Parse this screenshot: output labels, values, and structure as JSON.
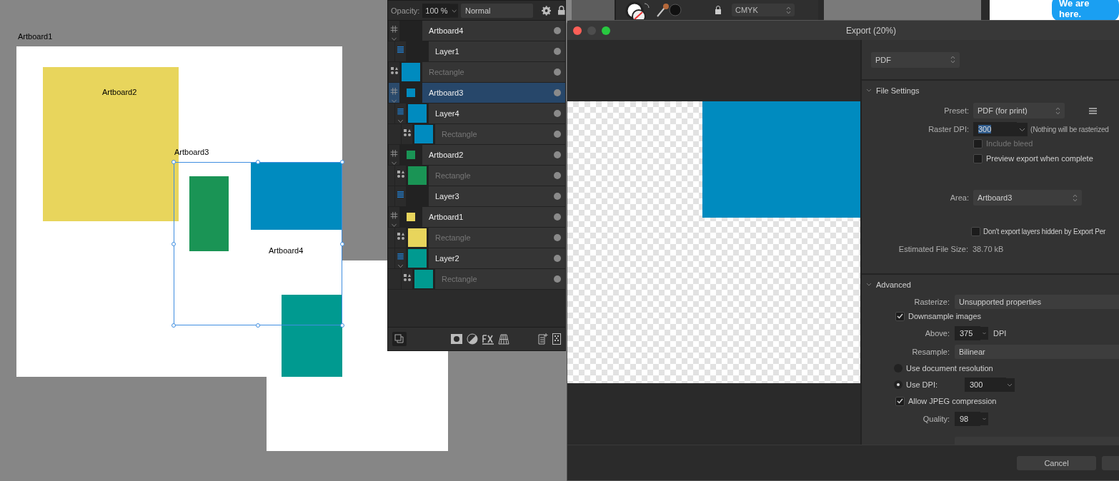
{
  "canvas": {
    "artboards": [
      {
        "label": "Artboard1",
        "selected": false
      },
      {
        "label": "Artboard2",
        "selected": false
      },
      {
        "label": "Artboard3",
        "selected": true
      },
      {
        "label": "Artboard4",
        "selected": false
      }
    ]
  },
  "background_windows": {
    "color_mode": "CMYK",
    "chat_bubble": "We are here."
  },
  "layers_panel": {
    "opacity_label": "Opacity:",
    "opacity": "100 %",
    "blend_mode": "Normal",
    "layers": [
      {
        "name": "Artboard4",
        "kind": "artboard",
        "selected": false,
        "expanded": true,
        "children": [
          {
            "name": "Layer1",
            "kind": "layer",
            "selected": false
          }
        ]
      },
      {
        "name": "Rectangle",
        "kind": "shape",
        "selected": false,
        "color": "#008bbf"
      },
      {
        "name": "Artboard3",
        "kind": "artboard",
        "selected": true,
        "expanded": true,
        "color": "#008bbf",
        "children": [
          {
            "name": "Layer4",
            "kind": "layer",
            "selected": false,
            "expanded": true,
            "color": "#008bbf",
            "children": [
              {
                "name": "Rectangle",
                "kind": "shape",
                "selected": false,
                "color": "#008bbf"
              }
            ]
          }
        ]
      },
      {
        "name": "Artboard2",
        "kind": "artboard",
        "selected": false,
        "expanded": true,
        "color": "#1a9455",
        "children": [
          {
            "name": "Rectangle",
            "kind": "shape",
            "selected": false,
            "color": "#1a9455"
          },
          {
            "name": "Layer3",
            "kind": "layer",
            "selected": false
          }
        ]
      },
      {
        "name": "Artboard1",
        "kind": "artboard",
        "selected": false,
        "expanded": true,
        "color": "#e8d55c",
        "children": [
          {
            "name": "Rectangle",
            "kind": "shape",
            "selected": false,
            "color": "#e8d55c"
          },
          {
            "name": "Layer2",
            "kind": "layer",
            "selected": false,
            "expanded": true,
            "color": "#009a90",
            "children": [
              {
                "name": "Rectangle",
                "kind": "shape",
                "selected": false,
                "color": "#009a90"
              }
            ]
          }
        ]
      }
    ]
  },
  "export_dialog": {
    "title": "Export (20%)",
    "format": "PDF",
    "file_settings": {
      "title": "File Settings",
      "expanded": true,
      "preset_label": "Preset:",
      "preset": "PDF (for print)",
      "raster_dpi_label": "Raster DPI:",
      "raster_dpi": "300",
      "raster_note": "(Nothing will be rasterized",
      "options": [
        {
          "label": "Include bleed",
          "checked": false,
          "disabled": true
        },
        {
          "label": "Preview export when complete",
          "checked": false,
          "disabled": false
        }
      ],
      "area_label": "Area:",
      "area": "Artboard3",
      "hidden_layers": {
        "label": "Don't export layers hidden by Export Per",
        "checked": false
      },
      "file_size_label": "Estimated File Size:",
      "file_size": "38.70 kB"
    },
    "advanced": {
      "title": "Advanced",
      "expanded": true,
      "rasterize_label": "Rasterize:",
      "rasterize": "Unsupported properties",
      "downsample": {
        "label": "Downsample images",
        "checked": true
      },
      "above_label": "Above:",
      "above": "375",
      "above_unit": "DPI",
      "resample_label": "Resample:",
      "resample": "Bilinear",
      "resolution_options": [
        {
          "label": "Use document resolution",
          "selected": false
        },
        {
          "label": "Use DPI:",
          "selected": true
        }
      ],
      "dpi": "300",
      "jpeg": {
        "label": "Allow JPEG compression",
        "checked": true
      },
      "quality_label": "Quality:",
      "quality": "98"
    },
    "cancel_button": "Cancel"
  }
}
